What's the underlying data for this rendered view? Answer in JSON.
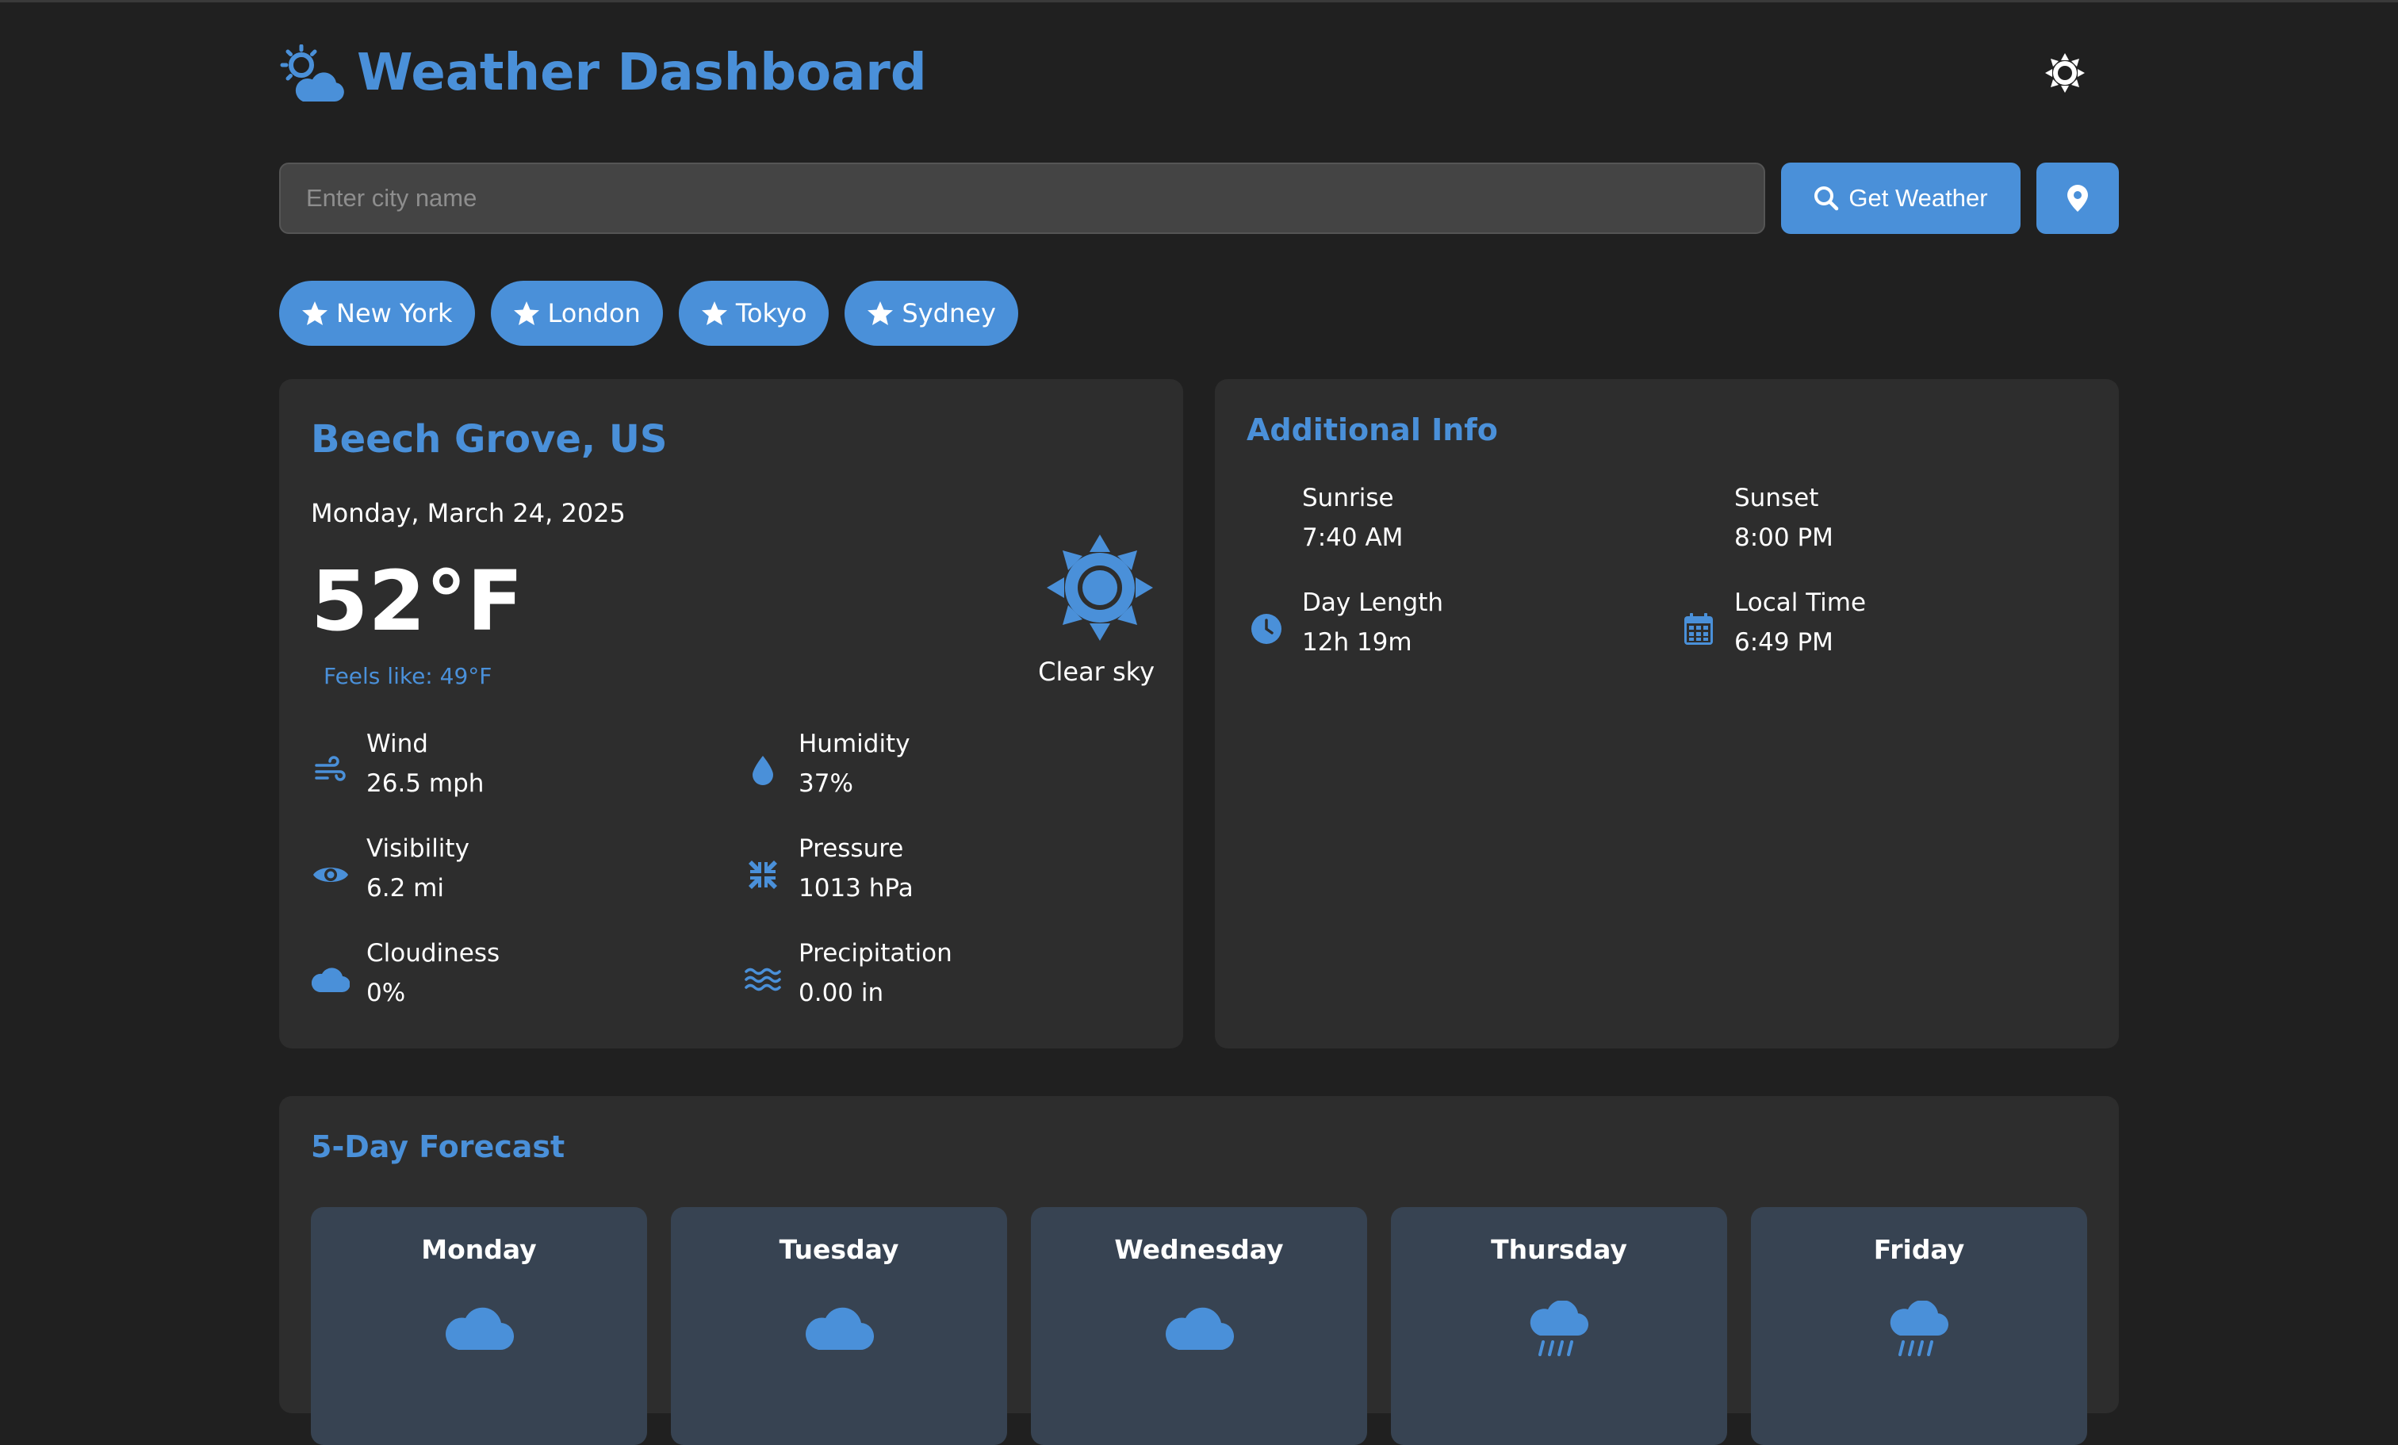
{
  "app": {
    "title": "Weather Dashboard",
    "accent_color": "#4a90d9",
    "background_color": "#202020",
    "card_color": "#2d2d2d"
  },
  "header": {
    "logo_icon": "sun-behind-cloud-icon",
    "theme_toggle_icon": "sun-icon"
  },
  "search": {
    "placeholder": "Enter city name",
    "value": "",
    "button_label": "Get Weather",
    "button_icon": "search-icon",
    "location_icon": "map-pin-icon"
  },
  "favorites": [
    {
      "label": "New York",
      "icon": "star-icon"
    },
    {
      "label": "London",
      "icon": "star-icon"
    },
    {
      "label": "Tokyo",
      "icon": "star-icon"
    },
    {
      "label": "Sydney",
      "icon": "star-icon"
    }
  ],
  "current": {
    "location": "Beech Grove, US",
    "date": "Monday, March 24, 2025",
    "temperature": "52°F",
    "feels_like": "Feels like: 49°F",
    "condition": "Clear sky",
    "condition_icon": "sun-icon",
    "stats": [
      {
        "label": "Wind",
        "value": "26.5 mph",
        "icon": "wind-icon"
      },
      {
        "label": "Humidity",
        "value": "37%",
        "icon": "droplet-icon"
      },
      {
        "label": "Visibility",
        "value": "6.2 mi",
        "icon": "eye-icon"
      },
      {
        "label": "Pressure",
        "value": "1013 hPa",
        "icon": "compress-icon"
      },
      {
        "label": "Cloudiness",
        "value": "0%",
        "icon": "cloud-icon"
      },
      {
        "label": "Precipitation",
        "value": "0.00 in",
        "icon": "water-waves-icon"
      }
    ]
  },
  "additional": {
    "title": "Additional Info",
    "items": [
      {
        "label": "Sunrise",
        "value": "7:40 AM",
        "icon": ""
      },
      {
        "label": "Sunset",
        "value": "8:00 PM",
        "icon": ""
      },
      {
        "label": "Day Length",
        "value": "12h 19m",
        "icon": "clock-icon"
      },
      {
        "label": "Local Time",
        "value": "6:49 PM",
        "icon": "calendar-icon"
      }
    ]
  },
  "forecast": {
    "title": "5-Day Forecast",
    "days": [
      {
        "day": "Monday",
        "icon": "cloud-icon"
      },
      {
        "day": "Tuesday",
        "icon": "cloud-icon"
      },
      {
        "day": "Wednesday",
        "icon": "cloud-icon"
      },
      {
        "day": "Thursday",
        "icon": "cloud-rain-icon"
      },
      {
        "day": "Friday",
        "icon": "cloud-rain-icon"
      }
    ]
  }
}
